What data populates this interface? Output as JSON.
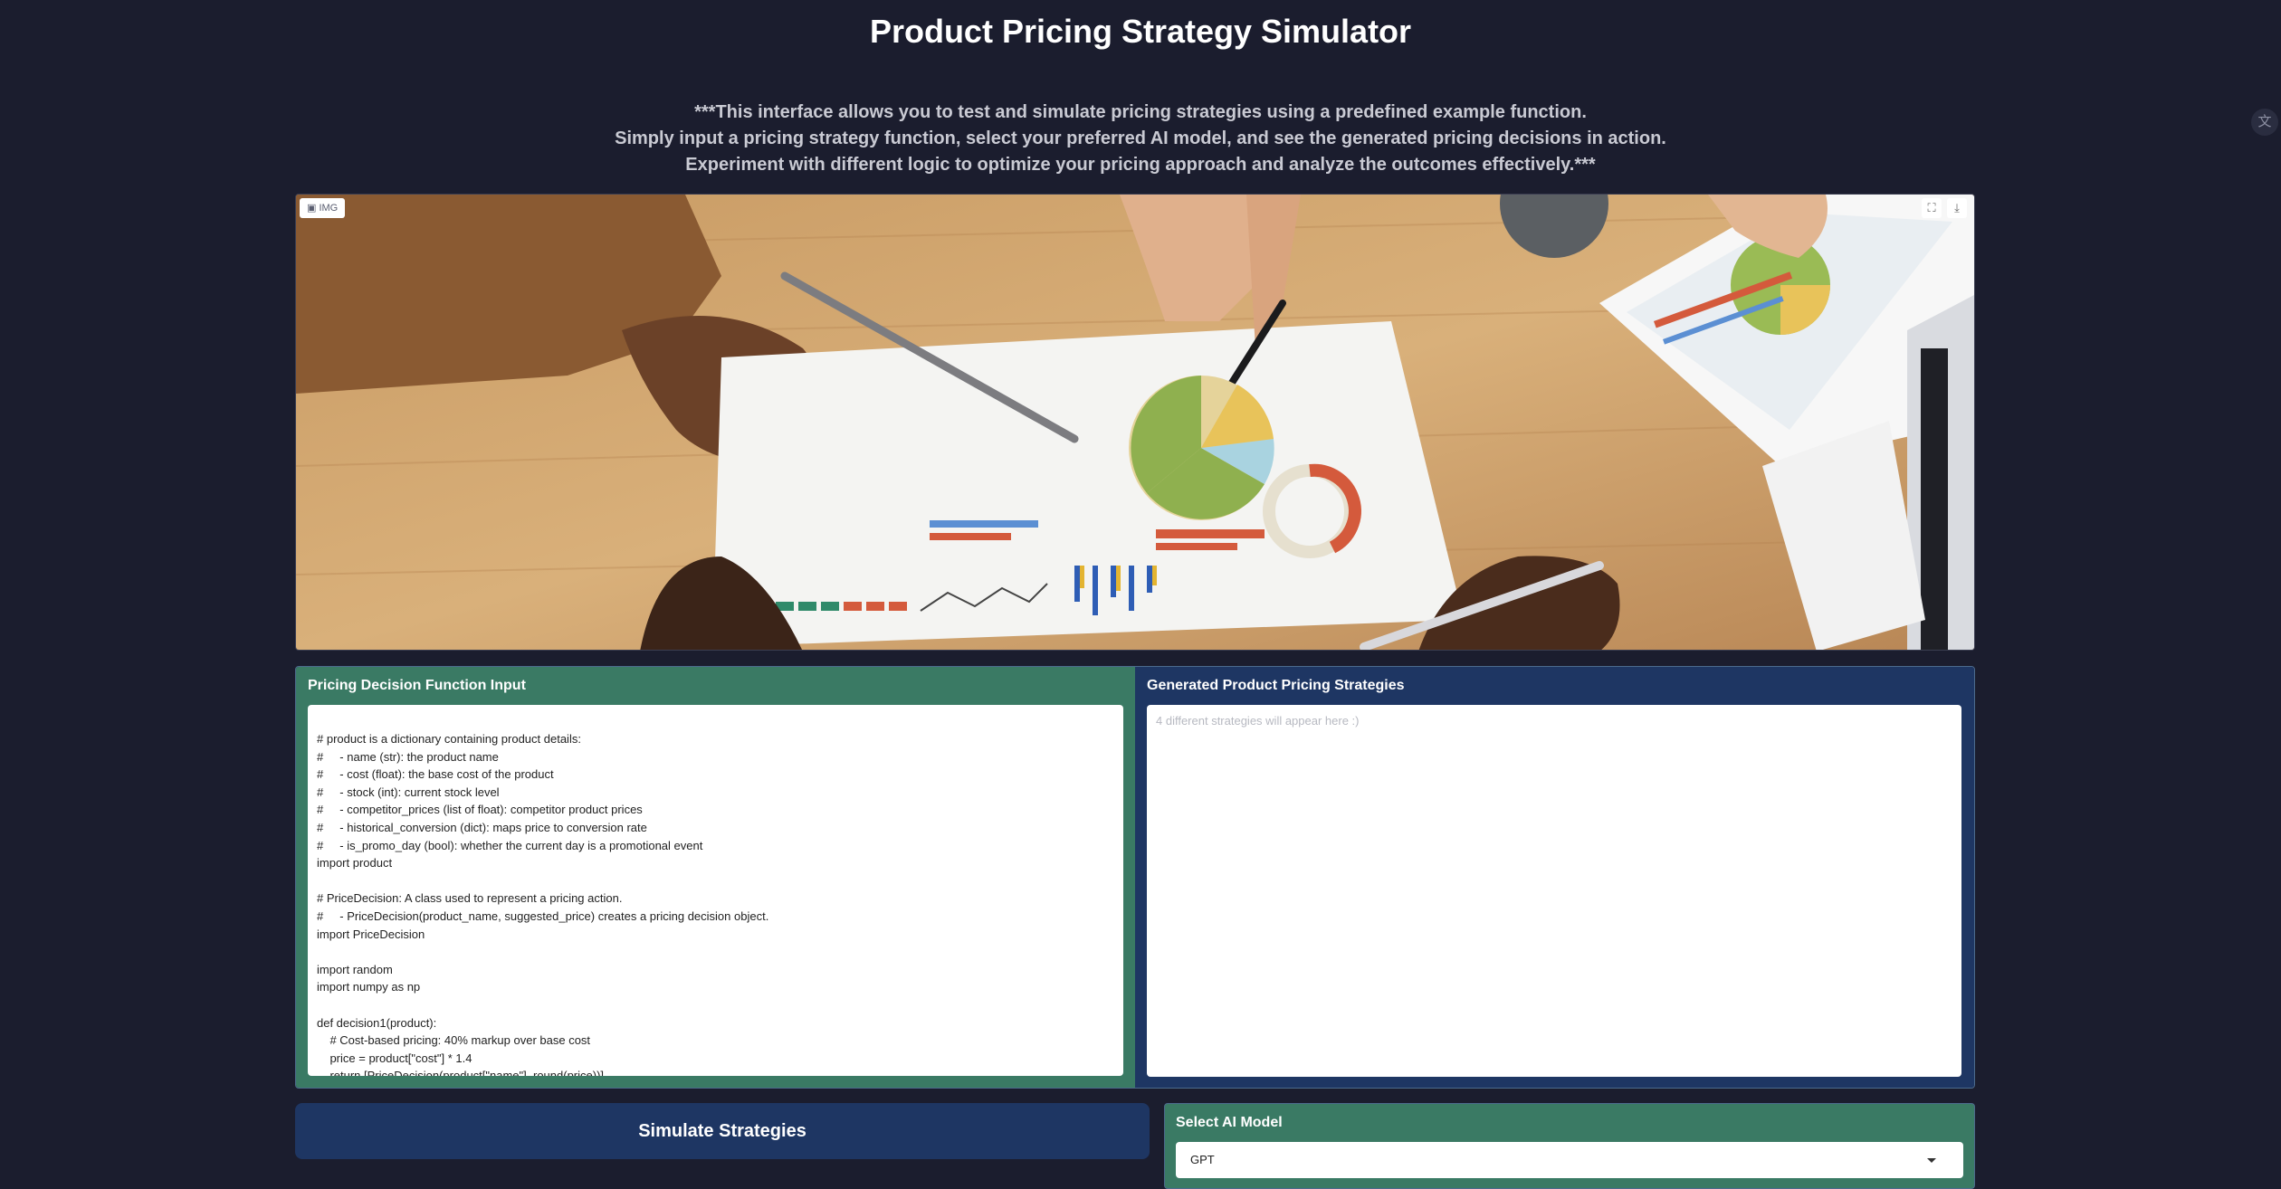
{
  "header": {
    "title": "Product Pricing Strategy Simulator",
    "description_lines": [
      "***This interface allows you to test and simulate pricing strategies using a predefined example function.",
      "Simply input a pricing strategy function, select your preferred AI model, and see the generated pricing decisions in action.",
      "Experiment with different logic to optimize your pricing approach and analyze the outcomes effectively.***"
    ]
  },
  "image": {
    "label": "IMG",
    "icons": [
      "expand-icon",
      "download-icon"
    ]
  },
  "input_panel": {
    "title": "Pricing Decision Function Input",
    "code": "# product is a dictionary containing product details:\n#     - name (str): the product name\n#     - cost (float): the base cost of the product\n#     - stock (int): current stock level\n#     - competitor_prices (list of float): competitor product prices\n#     - historical_conversion (dict): maps price to conversion rate\n#     - is_promo_day (bool): whether the current day is a promotional event\nimport product\n\n# PriceDecision: A class used to represent a pricing action.\n#     - PriceDecision(product_name, suggested_price) creates a pricing decision object.\nimport PriceDecision\n\nimport random\nimport numpy as np\n\ndef decision1(product):\n    # Cost-based pricing: 40% markup over base cost\n    price = product[\"cost\"] * 1.4\n    return [PriceDecision(product[\"name\"], round(price))]"
  },
  "output_panel": {
    "title": "Generated Product Pricing Strategies",
    "placeholder": "4 different strategies will appear here :)"
  },
  "simulate_button": {
    "label": "Simulate Strategies"
  },
  "model_select": {
    "label": "Select AI Model",
    "value": "GPT"
  },
  "colors": {
    "background": "#1b1d2e",
    "green_panel": "#3a7a64",
    "navy_panel": "#1e3663"
  }
}
